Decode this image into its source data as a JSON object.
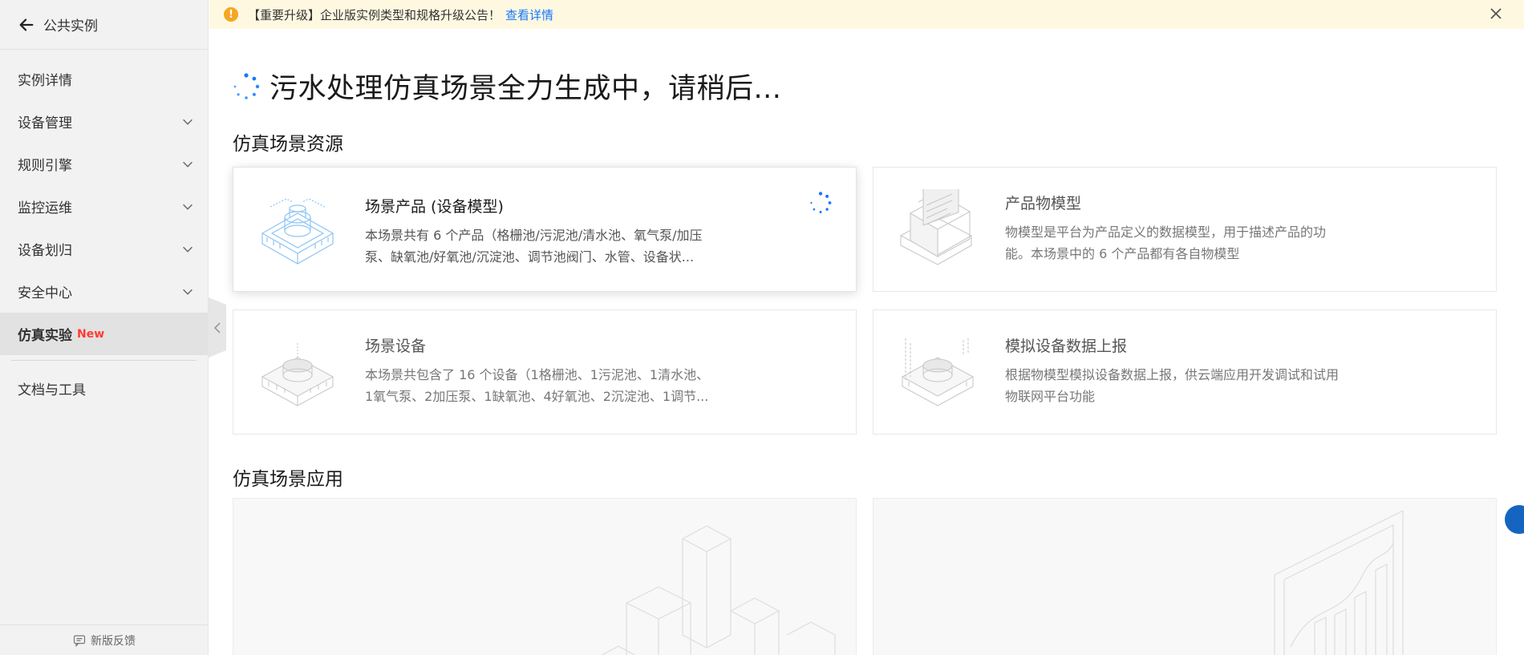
{
  "sidebar": {
    "back_label": "公共实例",
    "items": [
      {
        "label": "实例详情",
        "expandable": false
      },
      {
        "label": "设备管理",
        "expandable": true
      },
      {
        "label": "规则引擎",
        "expandable": true
      },
      {
        "label": "监控运维",
        "expandable": true
      },
      {
        "label": "设备划归",
        "expandable": true
      },
      {
        "label": "安全中心",
        "expandable": true
      }
    ],
    "active_item": {
      "label": "仿真实验",
      "badge": "New"
    },
    "docs_item": "文档与工具",
    "feedback": "新版反馈"
  },
  "notice": {
    "text": "【重要升级】企业版实例类型和规格升级公告！",
    "link": "查看详情",
    "warn_icon": "!"
  },
  "main": {
    "generating_title": "污水处理仿真场景全力生成中，请稍后...",
    "resources_title": "仿真场景资源",
    "apps_title": "仿真场景应用",
    "cards": [
      {
        "title": "场景产品 (设备模型)",
        "desc_line1": "本场景共有 6 个产品（格栅池/污泥池/清水池、氧气泵/加压",
        "desc_line2": "泵、缺氧池/好氧池/沉淀池、调节池阀门、水管、设备状..."
      },
      {
        "title": "产品物模型",
        "desc_line1": "物模型是平台为产品定义的数据模型，用于描述产品的功",
        "desc_line2": "能。本场景中的 6 个产品都有各自物模型"
      },
      {
        "title": "场景设备",
        "desc_line1": "本场景共包含了 16 个设备（1格栅池、1污泥池、1清水池、",
        "desc_line2": "1氧气泵、2加压泵、1缺氧池、4好氧池、2沉淀池、1调节..."
      },
      {
        "title": "模拟设备数据上报",
        "desc_line1": "根据物模型模拟设备数据上报，供云端应用开发调试和试用",
        "desc_line2": "物联网平台功能"
      }
    ]
  },
  "colors": {
    "accent": "#1677ff",
    "new_badge": "#ff3b30",
    "notice_bg": "#fff8e1",
    "warn": "#f5a623"
  }
}
